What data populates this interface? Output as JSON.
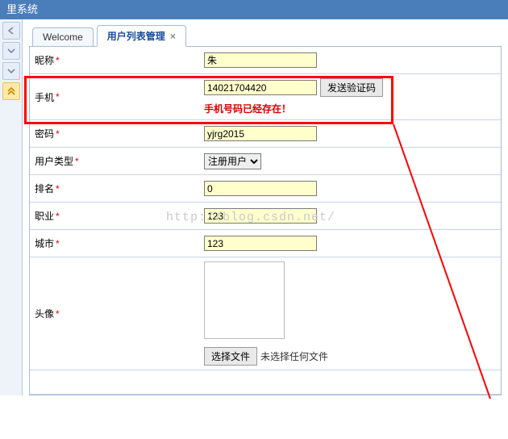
{
  "header": {
    "title_suffix": "里系统"
  },
  "tabs": {
    "welcome": "Welcome",
    "user_list": "用户列表管理"
  },
  "form": {
    "nickname": {
      "label": "昵称",
      "value": "朱"
    },
    "phone": {
      "label": "手机",
      "value": "14021704420",
      "send_code": "发送验证码",
      "error": "手机号码已经存在！"
    },
    "password": {
      "label": "密码",
      "value": "yjrg2015"
    },
    "user_type": {
      "label": "用户类型",
      "selected": "注册用户"
    },
    "rank": {
      "label": "排名",
      "value": "0"
    },
    "occupation": {
      "label": "职业",
      "value": "123"
    },
    "city": {
      "label": "城市",
      "value": "123"
    },
    "avatar": {
      "label": "头像",
      "choose_file": "选择文件",
      "no_file": "未选择任何文件"
    }
  },
  "watermark": "http://blog.csdn.net/"
}
